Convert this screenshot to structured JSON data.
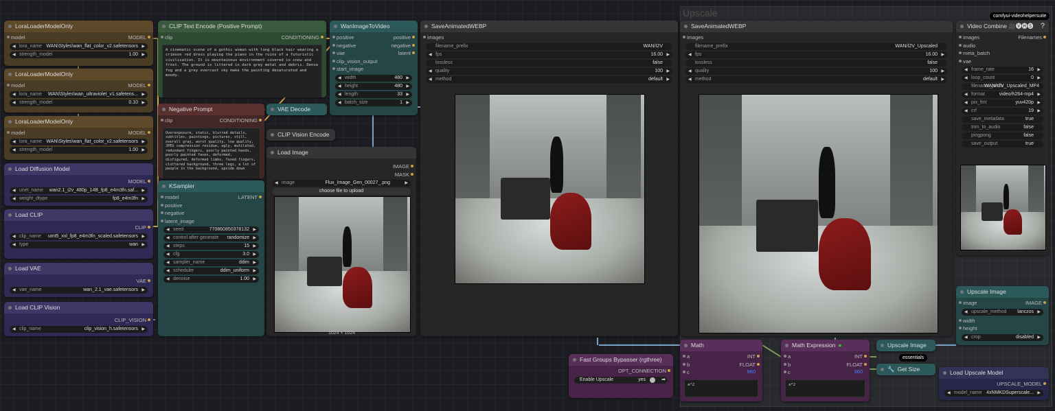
{
  "group": {
    "title": "Upscale"
  },
  "badges": {
    "vhs": "comfyui-videohelpersuite",
    "essentials": "essentials"
  },
  "lora1": {
    "title": "LoraLoaderModelOnly",
    "in": "model",
    "out": "MODEL",
    "lora_label": "lora_name",
    "lora": "WAN\\Styles\\wan_flat_color_v2.safetensors",
    "strength_label": "strength_model",
    "strength": "1.00"
  },
  "lora2": {
    "title": "LoraLoaderModelOnly",
    "in": "model",
    "out": "MODEL",
    "lora_label": "lora_name",
    "lora": "WAN\\Styles\\wan_ultraviolet_v1.safetens...",
    "strength_label": "strength_model",
    "strength": "0.10"
  },
  "lora3": {
    "title": "LoraLoaderModelOnly",
    "in": "model",
    "out": "MODEL",
    "lora_label": "lora_name",
    "lora": "WAN\\Styles\\wan_flat_color_v2.safetensors",
    "strength_label": "strength_model",
    "strength": "1.00"
  },
  "diffusion": {
    "title": "Load Diffusion Model",
    "out": "MODEL",
    "unet_label": "unet_name",
    "unet": "wan2.1_i2v_480p_14B_fp8_e4m3fn.saf...",
    "dtype_label": "weight_dtype",
    "dtype": "fp8_e4m3fn"
  },
  "clip": {
    "title": "Load CLIP",
    "out": "CLIP",
    "name_label": "clip_name",
    "name": "umt5_xxl_fp8_e4m3fn_scaled.safetensors",
    "type_label": "type",
    "type": "wan"
  },
  "vae": {
    "title": "Load VAE",
    "out": "VAE",
    "name_label": "vae_name",
    "name": "wan_2.1_vae.safetensors"
  },
  "clipvision": {
    "title": "Load CLIP Vision",
    "out": "CLIP_VISION",
    "name_label": "clip_name",
    "name": "clip_vision_h.safetensors"
  },
  "pos": {
    "title": "CLIP Text Encode (Positive Prompt)",
    "in": "clip",
    "out": "CONDITIONING",
    "text": "A cinematic scene of a gothic woman with long black hair wearing a crimson red dress playing the piano in the ruins of a futuristic civilisation. It is mountainous environment covered in snow and frost. The ground is littered in dark grey metal and debris. Dense fog and a grey overcast sky make the painting desaturated and moody."
  },
  "neg": {
    "title": "Negative Prompt",
    "in": "clip",
    "out": "CONDITIONING",
    "text": "Overexposure, static, blurred details, subtitles, paintings, pictures, still, overall gray, worst quality, low quality, JPEG compression residue, ugly, mutilated, redundant fingers, poorly painted hands, poorly painted faces, deformed, disfigured, deformed limbs, fused fingers, cluttered background, three legs, a lot of people in the background, upside down"
  },
  "ksampler": {
    "title": "KSampler",
    "ins": [
      "model",
      "positive",
      "negative",
      "latent_image"
    ],
    "out": "LATENT",
    "widgets": [
      {
        "l": "seed",
        "v": "770860850378132"
      },
      {
        "l": "control after generate",
        "v": "randomize"
      },
      {
        "l": "steps",
        "v": "15"
      },
      {
        "l": "cfg",
        "v": "3.0"
      },
      {
        "l": "sampler_name",
        "v": "ddim"
      },
      {
        "l": "scheduler",
        "v": "ddim_uniform"
      },
      {
        "l": "denoise",
        "v": "1.00"
      }
    ]
  },
  "vaedecode": {
    "title": "VAE Decode"
  },
  "cvencode": {
    "title": "CLIP Vision Encode"
  },
  "loadimage": {
    "title": "Load Image",
    "out1": "IMAGE",
    "out2": "MASK",
    "img_label": "image",
    "img": "Flux_Image_Gen_00027_.png",
    "upload": "choose file to upload",
    "dims": "1024 × 1024"
  },
  "wan": {
    "title": "WanImageToVideo",
    "ins": [
      "positive",
      "negative",
      "vae",
      "clip_vision_output",
      "start_image"
    ],
    "outs": [
      "positive",
      "negative",
      "latent"
    ],
    "widgets": [
      {
        "l": "width",
        "v": "480"
      },
      {
        "l": "height",
        "v": "480"
      },
      {
        "l": "length",
        "v": "33"
      },
      {
        "l": "batch_size",
        "v": "1"
      }
    ]
  },
  "save1": {
    "title": "SaveAnimatedWEBP",
    "in": "images",
    "widgets": [
      {
        "l": "filename_prefix",
        "v": "WAN/I2V"
      },
      {
        "l": "fps",
        "v": "16.00"
      },
      {
        "l": "lossless",
        "v": "false"
      },
      {
        "l": "quality",
        "v": "100"
      },
      {
        "l": "method",
        "v": "default"
      }
    ]
  },
  "save2": {
    "title": "SaveAnimatedWEBP",
    "in": "images",
    "widgets": [
      {
        "l": "filename_prefix",
        "v": "WAN/I2V_Upscaled"
      },
      {
        "l": "fps",
        "v": "16.00"
      },
      {
        "l": "lossless",
        "v": "false"
      },
      {
        "l": "quality",
        "v": "100"
      },
      {
        "l": "method",
        "v": "default"
      }
    ]
  },
  "vcombine": {
    "title": "Video Combine 🎥🅥🅗🅢",
    "ins": [
      "images",
      "audio",
      "meta_batch",
      "vae"
    ],
    "out": "Filenames",
    "widgets": [
      {
        "l": "frame_rate",
        "v": "16"
      },
      {
        "l": "loop_count",
        "v": "0"
      },
      {
        "l": "filename_prefix",
        "v": "WAN/I2V_Upscaled_MP4"
      },
      {
        "l": "format",
        "v": "video/h264-mp4"
      },
      {
        "l": "pix_fmt",
        "v": "yuv420p"
      },
      {
        "l": "crf",
        "v": "19"
      },
      {
        "l": "save_metadata",
        "v": "true"
      },
      {
        "l": "trim_to_audio",
        "v": "false"
      },
      {
        "l": "pingpong",
        "v": "false"
      },
      {
        "l": "save_output",
        "v": "true"
      }
    ]
  },
  "upscaleimg": {
    "title": "Upscale Image",
    "ins": [
      "image",
      "width",
      "height"
    ],
    "out": "IMAGE",
    "widgets": [
      {
        "l": "upscale_method",
        "v": "lanczos"
      },
      {
        "l": "crop",
        "v": "disabled"
      }
    ]
  },
  "math": {
    "title": "Math",
    "ins": [
      "a",
      "b",
      "c"
    ],
    "outs": [
      "INT",
      "FLOAT"
    ],
    "c_val": "960",
    "expr": "a*2"
  },
  "mathexpr": {
    "title": "Math Expression",
    "ins": [
      "a",
      "b",
      "c"
    ],
    "outs": [
      "INT",
      "FLOAT"
    ],
    "c_val": "960",
    "expr": "a*2"
  },
  "bypass": {
    "title": "Fast Groups Bypasser (rgthree)",
    "out": "OPT_CONNECTION",
    "toggle_label": "Enable Upscale",
    "toggle_val": "yes"
  },
  "upscale_collapsed": {
    "title": "Upscale Image"
  },
  "getsize": {
    "title": "Get Size"
  },
  "upmodel": {
    "title": "Load Upscale Model",
    "out": "UPSCALE_MODEL",
    "name_label": "model_name",
    "name": "4xNMKDSuperscale..."
  }
}
